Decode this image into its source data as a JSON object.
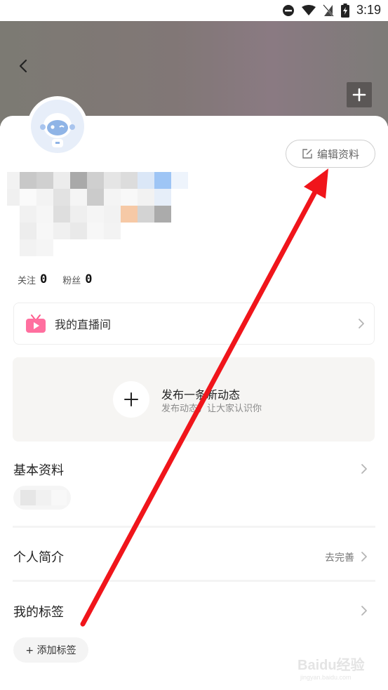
{
  "status_bar": {
    "time": "3:19",
    "icons": [
      "dnd-icon",
      "wifi-icon",
      "no-signal-icon",
      "battery-icon"
    ]
  },
  "header": {
    "back_icon": "chevron-left-icon",
    "add_icon": "plus-icon"
  },
  "profile": {
    "edit_label": "编辑资料"
  },
  "stats": {
    "following_label": "关注",
    "following_count": "0",
    "fans_label": "粉丝",
    "fans_count": "0"
  },
  "live": {
    "label": "我的直播间",
    "icon": "tv-play-icon"
  },
  "post": {
    "title": "发布一条新动态",
    "subtitle": "发布动态，让大家认识你"
  },
  "sections": {
    "basic_title": "基本资料",
    "intro_title": "个人简介",
    "intro_action": "去完善",
    "tags_title": "我的标签",
    "add_tag_label": "+ 添加标签"
  },
  "watermark": {
    "text": "Baidu经验",
    "subtext": "jingyan.baidu.com"
  },
  "colors": {
    "arrow": "#f0151b",
    "header_gray": "#817776",
    "post_bg": "#f6f5f3"
  }
}
